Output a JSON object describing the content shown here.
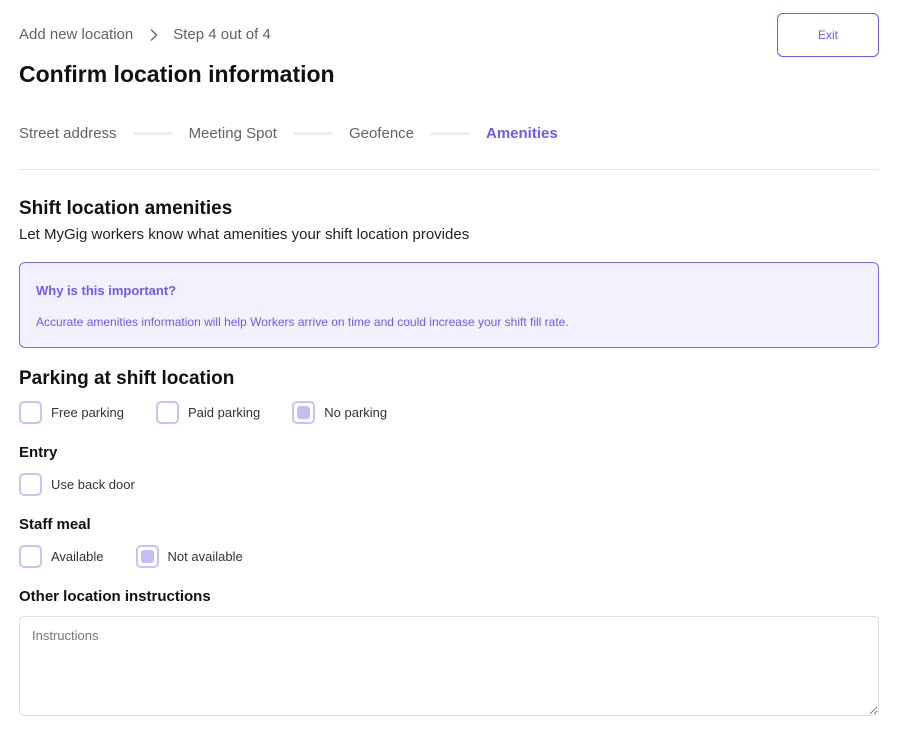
{
  "breadcrumb": {
    "parent": "Add new location",
    "current": "Step 4 out of 4"
  },
  "header": {
    "title": "Confirm location information",
    "exit_label": "Exit"
  },
  "steps": [
    {
      "label": "Street address",
      "active": false
    },
    {
      "label": "Meeting Spot",
      "active": false
    },
    {
      "label": "Geofence",
      "active": false
    },
    {
      "label": "Amenities",
      "active": true
    }
  ],
  "amenities": {
    "title": "Shift location amenities",
    "subtitle": "Let MyGig workers know what amenities your shift location provides"
  },
  "info": {
    "title": "Why is this important?",
    "text": "Accurate amenities information will help Workers arrive on time and could increase your shift fill rate."
  },
  "parking": {
    "title": "Parking at shift location",
    "options": [
      {
        "label": "Free parking",
        "checked": false
      },
      {
        "label": "Paid parking",
        "checked": false
      },
      {
        "label": "No parking",
        "checked": true
      }
    ]
  },
  "entry": {
    "title": "Entry",
    "options": [
      {
        "label": "Use back door",
        "checked": false
      }
    ]
  },
  "staff_meal": {
    "title": "Staff meal",
    "options": [
      {
        "label": "Available",
        "checked": false
      },
      {
        "label": "Not available",
        "checked": true
      }
    ]
  },
  "instructions": {
    "title": "Other location instructions",
    "placeholder": "Instructions",
    "value": ""
  },
  "colors": {
    "accent": "#6d5ce7",
    "info_bg": "#f4f1fe",
    "checkbox_border": "#c9c2f5",
    "checkbox_fill": "#c5bdf6"
  },
  "icons": {
    "breadcrumb_separator": "chevron-right-icon"
  }
}
